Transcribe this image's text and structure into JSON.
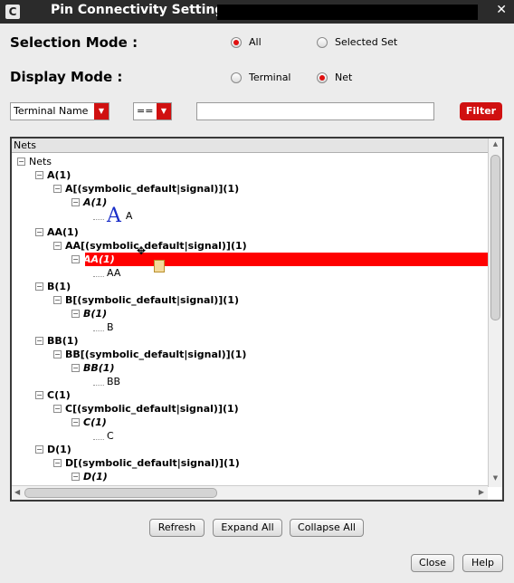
{
  "window": {
    "title": "Pin Connectivity Setting",
    "app_icon": "C"
  },
  "selection_mode": {
    "label": "Selection Mode :",
    "options": [
      "All",
      "Selected Set"
    ],
    "selected": "All"
  },
  "display_mode": {
    "label": "Display Mode :",
    "options": [
      "Terminal",
      "Net"
    ],
    "selected": "Net"
  },
  "filter": {
    "field_select": "Terminal Name",
    "operator": "==",
    "value": "",
    "button": "Filter"
  },
  "tree": {
    "header": "Nets",
    "root": "Nets",
    "nodes": [
      {
        "depth": 1,
        "label": "A(1)",
        "style": "b"
      },
      {
        "depth": 2,
        "label": "A[(symbolic_default|signal)](1)",
        "style": "b"
      },
      {
        "depth": 3,
        "label": "A(1)",
        "style": "bi"
      },
      {
        "depth": 4,
        "label": "A",
        "big": "A"
      },
      {
        "depth": 1,
        "label": "AA(1)",
        "style": "b"
      },
      {
        "depth": 2,
        "label": "AA[(symbolic_default|signal)](1)",
        "style": "b"
      },
      {
        "depth": 3,
        "label": "AA(1)",
        "style": "bi",
        "selected": true
      },
      {
        "depth": 4,
        "label": "AA"
      },
      {
        "depth": 1,
        "label": "B(1)",
        "style": "b"
      },
      {
        "depth": 2,
        "label": "B[(symbolic_default|signal)](1)",
        "style": "b"
      },
      {
        "depth": 3,
        "label": "B(1)",
        "style": "bi"
      },
      {
        "depth": 4,
        "label": "B"
      },
      {
        "depth": 1,
        "label": "BB(1)",
        "style": "b"
      },
      {
        "depth": 2,
        "label": "BB[(symbolic_default|signal)](1)",
        "style": "b"
      },
      {
        "depth": 3,
        "label": "BB(1)",
        "style": "bi"
      },
      {
        "depth": 4,
        "label": "BB"
      },
      {
        "depth": 1,
        "label": "C(1)",
        "style": "b"
      },
      {
        "depth": 2,
        "label": "C[(symbolic_default|signal)](1)",
        "style": "b"
      },
      {
        "depth": 3,
        "label": "C(1)",
        "style": "bi"
      },
      {
        "depth": 4,
        "label": "C"
      },
      {
        "depth": 1,
        "label": "D(1)",
        "style": "b"
      },
      {
        "depth": 2,
        "label": "D[(symbolic_default|signal)](1)",
        "style": "b"
      },
      {
        "depth": 3,
        "label": "D(1)",
        "style": "bi"
      }
    ]
  },
  "buttons": {
    "refresh": "Refresh",
    "expand_all": "Expand All",
    "collapse_all": "Collapse All",
    "close": "Close",
    "help": "Help"
  },
  "colors": {
    "accent": "#d01010",
    "titlebar": "#2b2b2b",
    "selection": "#ff0000"
  }
}
